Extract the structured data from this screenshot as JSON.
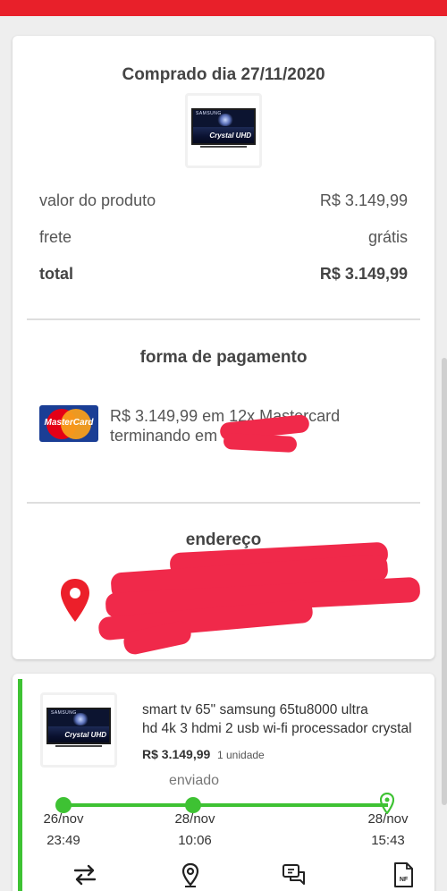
{
  "order": {
    "purchase_title": "Comprado dia 27/11/2020",
    "summary": {
      "product_label": "valor do produto",
      "product_value": "R$ 3.149,99",
      "shipping_label": "frete",
      "shipping_value": "grátis",
      "total_label": "total",
      "total_value": "R$ 3.149,99"
    },
    "payment": {
      "title": "forma de pagamento",
      "card_brand": "MasterCard",
      "line1": "R$ 3.149,99 em 12x Mastercard",
      "line2": "terminando em"
    },
    "address": {
      "title": "endereço"
    }
  },
  "item": {
    "thumbnail": {
      "brand": "SAMSUNG",
      "model": "Crystal UHD"
    },
    "name_line1": "smart tv 65\" samsung 65tu8000 ultra",
    "name_line2": "hd 4k 3 hdmi 2 usb wi-fi processador crystal",
    "price": "R$ 3.149,99",
    "quantity": "1 unidade",
    "status": "enviado",
    "timeline": [
      {
        "date": "26/nov",
        "time": "23:49"
      },
      {
        "date": "28/nov",
        "time": "10:06"
      },
      {
        "date": "28/nov",
        "time": "15:43"
      }
    ],
    "actions": [
      "exchange-icon",
      "location-pin-icon",
      "chat-icon",
      "invoice-nf-icon"
    ],
    "invoice_icon_text": "NF"
  },
  "colors": {
    "brand_red": "#e8202a",
    "progress_green": "#3ec233",
    "redaction": "#f0294a"
  }
}
